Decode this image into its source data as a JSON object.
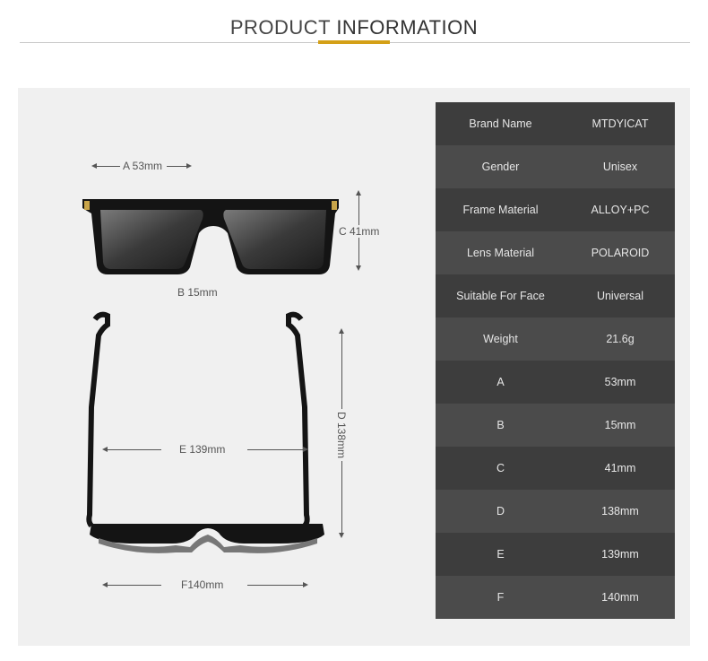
{
  "header": {
    "title_part1": "PRODUCT ",
    "title_part2": "INFORMATION"
  },
  "colors": {
    "accent": "#d4a017",
    "row_dark": "#3d3d3d",
    "row_light": "#4b4b4b",
    "panel": "#f0f0f0"
  },
  "specs": [
    {
      "label": "Brand Name",
      "value": "MTDYICAT"
    },
    {
      "label": "Gender",
      "value": "Unisex"
    },
    {
      "label": "Frame Material",
      "value": "ALLOY+PC"
    },
    {
      "label": "Lens Material",
      "value": "POLAROID"
    },
    {
      "label": "Suitable For Face",
      "value": "Universal"
    },
    {
      "label": "Weight",
      "value": "21.6g"
    },
    {
      "label": "A",
      "value": "53mm"
    },
    {
      "label": "B",
      "value": "15mm"
    },
    {
      "label": "C",
      "value": "41mm"
    },
    {
      "label": "D",
      "value": "138mm"
    },
    {
      "label": "E",
      "value": "139mm"
    },
    {
      "label": "F",
      "value": "140mm"
    }
  ],
  "dims": {
    "a": "A 53mm",
    "b": "B 15mm",
    "c": "C 41mm",
    "d": "D 138mm",
    "e": "E 139mm",
    "f": "F140mm"
  }
}
